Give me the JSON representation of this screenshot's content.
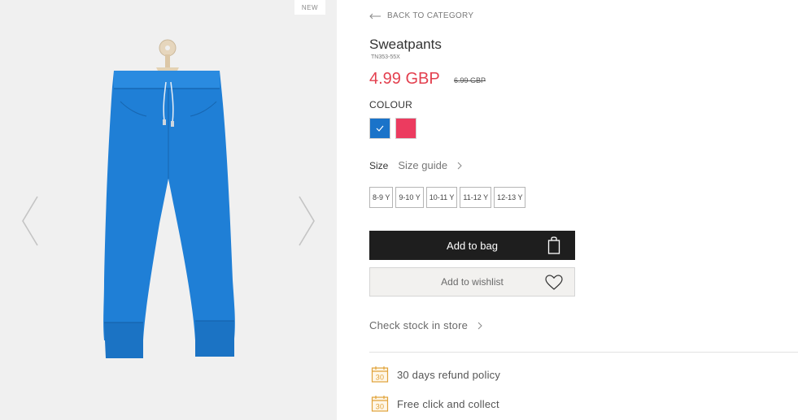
{
  "gallery": {
    "badge": "NEW",
    "product_color": "#1f7fd6"
  },
  "nav": {
    "back_label": "BACK TO CATEGORY"
  },
  "product": {
    "title": "Sweatpants",
    "sku": "TN353-55X",
    "price": "4.99 GBP",
    "old_price": "6.99 GBP"
  },
  "colour": {
    "label": "COLOUR",
    "options": [
      {
        "hex": "#1a73c9",
        "selected": true
      },
      {
        "hex": "#ec3b5f",
        "selected": false
      }
    ]
  },
  "size": {
    "label": "Size",
    "guide_label": "Size guide",
    "options": [
      "8-9 Y",
      "9-10 Y",
      "10-11 Y",
      "11-12 Y",
      "12-13 Y"
    ]
  },
  "actions": {
    "add_to_bag": "Add to bag",
    "add_to_wishlist": "Add to wishlist",
    "check_stock": "Check stock in store"
  },
  "features": [
    {
      "icon": "calendar-30-icon",
      "icon_text": "30",
      "label": "30 days refund policy"
    },
    {
      "icon": "calendar-30-icon",
      "icon_text": "30",
      "label": "Free click and collect"
    }
  ],
  "colors": {
    "accent_price": "#e3404f",
    "button_dark": "#1e1e1e",
    "icon_gold": "#e0a23a"
  }
}
